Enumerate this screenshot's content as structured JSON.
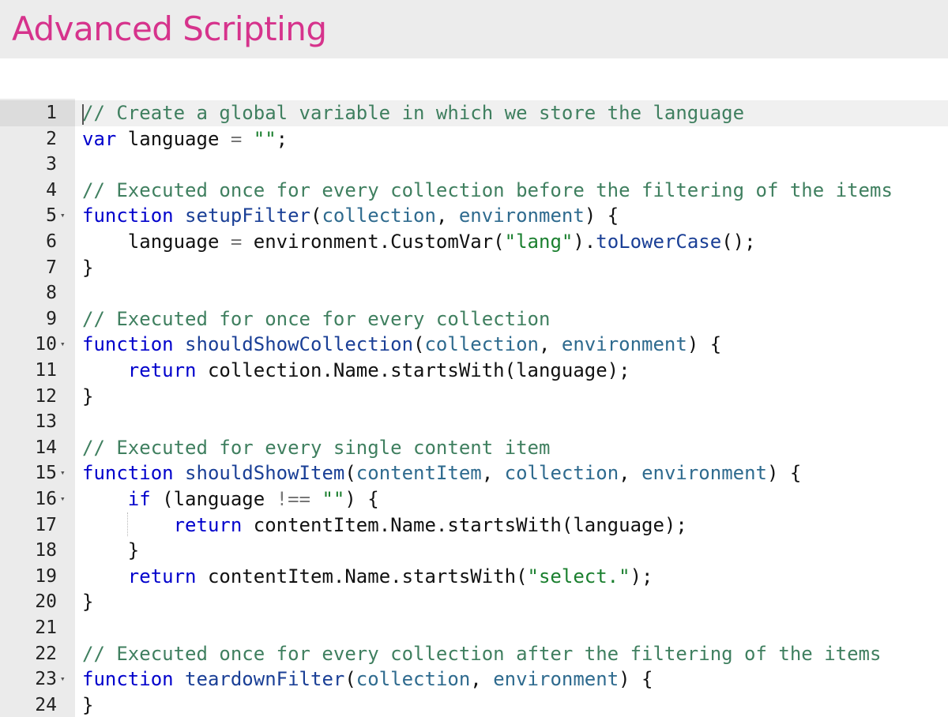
{
  "header": {
    "title": "Advanced Scripting"
  },
  "editor": {
    "active_line": 1,
    "lines": [
      {
        "n": "1",
        "fold": false,
        "tokens": [
          [
            "cm",
            "// Create a global variable in which we store the language"
          ]
        ]
      },
      {
        "n": "2",
        "fold": false,
        "tokens": [
          [
            "kw",
            "var"
          ],
          [
            "pn",
            " language "
          ],
          [
            "op",
            "="
          ],
          [
            "pn",
            " "
          ],
          [
            "str",
            "\"\""
          ],
          [
            "pn",
            ";"
          ]
        ]
      },
      {
        "n": "3",
        "fold": false,
        "tokens": []
      },
      {
        "n": "4",
        "fold": false,
        "tokens": [
          [
            "cm",
            "// Executed once for every collection before the filtering of the items"
          ]
        ]
      },
      {
        "n": "5",
        "fold": true,
        "tokens": [
          [
            "kw",
            "function"
          ],
          [
            "pn",
            " "
          ],
          [
            "fn",
            "setupFilter"
          ],
          [
            "pn",
            "("
          ],
          [
            "pa",
            "collection"
          ],
          [
            "pn",
            ", "
          ],
          [
            "pa",
            "environment"
          ],
          [
            "pn",
            ") {"
          ]
        ]
      },
      {
        "n": "6",
        "fold": false,
        "tokens": [
          [
            "pn",
            "    language "
          ],
          [
            "op",
            "="
          ],
          [
            "pn",
            " environment.CustomVar("
          ],
          [
            "str",
            "\"lang\""
          ],
          [
            "pn",
            ")."
          ],
          [
            "fn",
            "toLowerCase"
          ],
          [
            "pn",
            "();"
          ]
        ]
      },
      {
        "n": "7",
        "fold": false,
        "tokens": [
          [
            "pn",
            "}"
          ]
        ]
      },
      {
        "n": "8",
        "fold": false,
        "tokens": []
      },
      {
        "n": "9",
        "fold": false,
        "tokens": [
          [
            "cm",
            "// Executed for once for every collection"
          ]
        ]
      },
      {
        "n": "10",
        "fold": true,
        "tokens": [
          [
            "kw",
            "function"
          ],
          [
            "pn",
            " "
          ],
          [
            "fn",
            "shouldShowCollection"
          ],
          [
            "pn",
            "("
          ],
          [
            "pa",
            "collection"
          ],
          [
            "pn",
            ", "
          ],
          [
            "pa",
            "environment"
          ],
          [
            "pn",
            ") {"
          ]
        ]
      },
      {
        "n": "11",
        "fold": false,
        "tokens": [
          [
            "pn",
            "    "
          ],
          [
            "kw",
            "return"
          ],
          [
            "pn",
            " collection.Name.startsWith(language);"
          ]
        ]
      },
      {
        "n": "12",
        "fold": false,
        "tokens": [
          [
            "pn",
            "}"
          ]
        ]
      },
      {
        "n": "13",
        "fold": false,
        "tokens": []
      },
      {
        "n": "14",
        "fold": false,
        "tokens": [
          [
            "cm",
            "// Executed for every single content item"
          ]
        ]
      },
      {
        "n": "15",
        "fold": true,
        "tokens": [
          [
            "kw",
            "function"
          ],
          [
            "pn",
            " "
          ],
          [
            "fn",
            "shouldShowItem"
          ],
          [
            "pn",
            "("
          ],
          [
            "pa",
            "contentItem"
          ],
          [
            "pn",
            ", "
          ],
          [
            "pa",
            "collection"
          ],
          [
            "pn",
            ", "
          ],
          [
            "pa",
            "environment"
          ],
          [
            "pn",
            ") {"
          ]
        ]
      },
      {
        "n": "16",
        "fold": true,
        "tokens": [
          [
            "pn",
            "    "
          ],
          [
            "kw",
            "if"
          ],
          [
            "pn",
            " (language "
          ],
          [
            "op",
            "!=="
          ],
          [
            "pn",
            " "
          ],
          [
            "str",
            "\"\""
          ],
          [
            "pn",
            ") {"
          ]
        ]
      },
      {
        "n": "17",
        "fold": false,
        "guide": true,
        "tokens": [
          [
            "pn",
            "        "
          ],
          [
            "kw",
            "return"
          ],
          [
            "pn",
            " contentItem.Name.startsWith(language);"
          ]
        ]
      },
      {
        "n": "18",
        "fold": false,
        "tokens": [
          [
            "pn",
            "    }"
          ]
        ]
      },
      {
        "n": "19",
        "fold": false,
        "tokens": [
          [
            "pn",
            "    "
          ],
          [
            "kw",
            "return"
          ],
          [
            "pn",
            " contentItem.Name.startsWith("
          ],
          [
            "str",
            "\"select.\""
          ],
          [
            "pn",
            ");"
          ]
        ]
      },
      {
        "n": "20",
        "fold": false,
        "tokens": [
          [
            "pn",
            "}"
          ]
        ]
      },
      {
        "n": "21",
        "fold": false,
        "tokens": []
      },
      {
        "n": "22",
        "fold": false,
        "tokens": [
          [
            "cm",
            "// Executed once for every collection after the filtering of the items"
          ]
        ]
      },
      {
        "n": "23",
        "fold": true,
        "tokens": [
          [
            "kw",
            "function"
          ],
          [
            "pn",
            " "
          ],
          [
            "fn",
            "teardownFilter"
          ],
          [
            "pn",
            "("
          ],
          [
            "pa",
            "collection"
          ],
          [
            "pn",
            ", "
          ],
          [
            "pa",
            "environment"
          ],
          [
            "pn",
            ") {"
          ]
        ]
      },
      {
        "n": "24",
        "fold": false,
        "tokens": [
          [
            "pn",
            "}"
          ]
        ]
      }
    ]
  }
}
